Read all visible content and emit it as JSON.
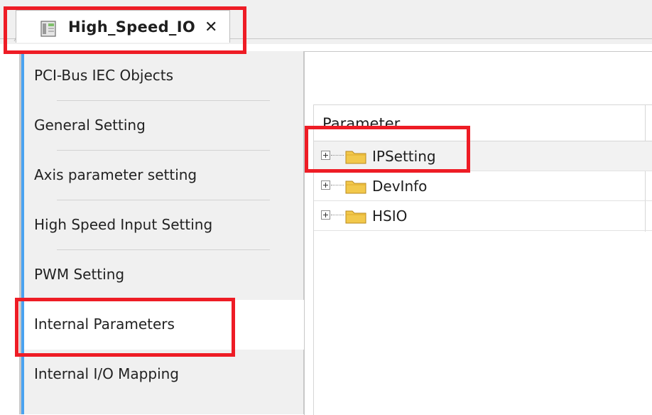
{
  "tab": {
    "title": "High_Speed_IO",
    "close_glyph": "✕",
    "icon": "device-module-icon"
  },
  "nav": {
    "items": [
      {
        "label": "PCI-Bus IEC Objects"
      },
      {
        "label": "General Setting"
      },
      {
        "label": "Axis parameter setting"
      },
      {
        "label": "High Speed Input Setting"
      },
      {
        "label": "PWM Setting"
      },
      {
        "label": "Internal Parameters"
      },
      {
        "label": "Internal I/O Mapping"
      }
    ],
    "active_label": "Internal Parameters"
  },
  "grid": {
    "header": "Parameter",
    "rows": [
      {
        "label": "IPSetting",
        "icon": "folder-icon",
        "expand_icon": "plus-expander-icon"
      },
      {
        "label": "DevInfo",
        "icon": "folder-icon",
        "expand_icon": "plus-expander-icon"
      },
      {
        "label": "HSIO",
        "icon": "folder-icon",
        "expand_icon": "plus-expander-icon"
      }
    ]
  },
  "colors": {
    "highlight_box": "#ee1c25",
    "nav_accent": "#4aa3f0",
    "panel_background": "#f0f0f0",
    "folder_fill": "#f2c84b"
  }
}
